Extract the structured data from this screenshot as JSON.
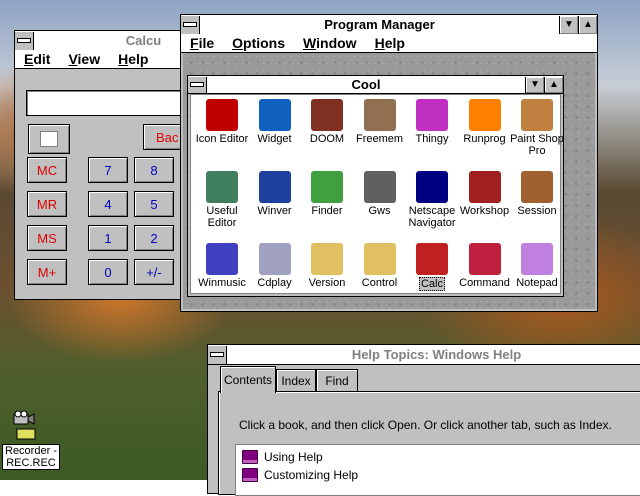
{
  "calculator": {
    "title": "Calcu",
    "menu": [
      "Edit",
      "View",
      "Help"
    ],
    "display_value": "",
    "back_label": "Bac",
    "memory_buttons": [
      "MC",
      "MR",
      "MS",
      "M+"
    ],
    "col1": [
      "7",
      "4",
      "1",
      "0"
    ],
    "col2": [
      "8",
      "5",
      "2",
      "+/-"
    ]
  },
  "program_manager": {
    "title": "Program Manager",
    "menu": [
      "File",
      "Options",
      "Window",
      "Help"
    ],
    "group": {
      "title": "Cool",
      "icons": [
        {
          "label": "Icon Editor",
          "icon": "icon-editor-icon",
          "color": "#c00000"
        },
        {
          "label": "Widget",
          "icon": "globe-icon",
          "color": "#1060c0"
        },
        {
          "label": "DOOM",
          "icon": "doom-demon-icon",
          "color": "#803020"
        },
        {
          "label": "Freemem",
          "icon": "skull-icon",
          "color": "#907050"
        },
        {
          "label": "Thingy",
          "icon": "thingy-icon",
          "color": "#c030c0"
        },
        {
          "label": "Runprog",
          "icon": "rainbow-icon",
          "color": "#ff8000"
        },
        {
          "label": "Paint Shop Pro",
          "icon": "paint-bucket-icon",
          "color": "#c08040"
        },
        {
          "label": "Useful Editor",
          "icon": "useful-editor-icon",
          "color": "#408060"
        },
        {
          "label": "Winver",
          "icon": "windows-logo-icon",
          "color": "#2040a0"
        },
        {
          "label": "Finder",
          "icon": "apple-icon",
          "color": "#40a040"
        },
        {
          "label": "Gws",
          "icon": "eye-icon",
          "color": "#606060"
        },
        {
          "label": "Netscape Navigator",
          "icon": "netscape-icon",
          "color": "#000080"
        },
        {
          "label": "Workshop",
          "icon": "spheres-icon",
          "color": "#a02020"
        },
        {
          "label": "Session",
          "icon": "speaker-icon",
          "color": "#a06030"
        },
        {
          "label": "Winmusic",
          "icon": "music-note-icon",
          "color": "#4040c0"
        },
        {
          "label": "Cdplay",
          "icon": "cd-icon",
          "color": "#a0a0c0"
        },
        {
          "label": "Version",
          "icon": "folder-icon",
          "color": "#e0c060"
        },
        {
          "label": "Control",
          "icon": "control-folder-icon",
          "color": "#e0c060"
        },
        {
          "label": "Calc",
          "icon": "calc-icon",
          "color": "#c02020"
        },
        {
          "label": "Command",
          "icon": "command-icon",
          "color": "#c02040"
        },
        {
          "label": "Notepad",
          "icon": "notepad-icon",
          "color": "#c080e0"
        }
      ],
      "selected": "Calc"
    }
  },
  "help": {
    "title": "Help Topics: Windows Help",
    "tabs": [
      "Contents",
      "Index",
      "Find"
    ],
    "active_tab": "Contents",
    "instruction": "Click a book, and then click Open. Or click another tab, such as Index.",
    "items": [
      "Using Help",
      "Customizing Help"
    ]
  },
  "recorder": {
    "label_line1": "Recorder -",
    "label_line2": "REC.REC"
  }
}
